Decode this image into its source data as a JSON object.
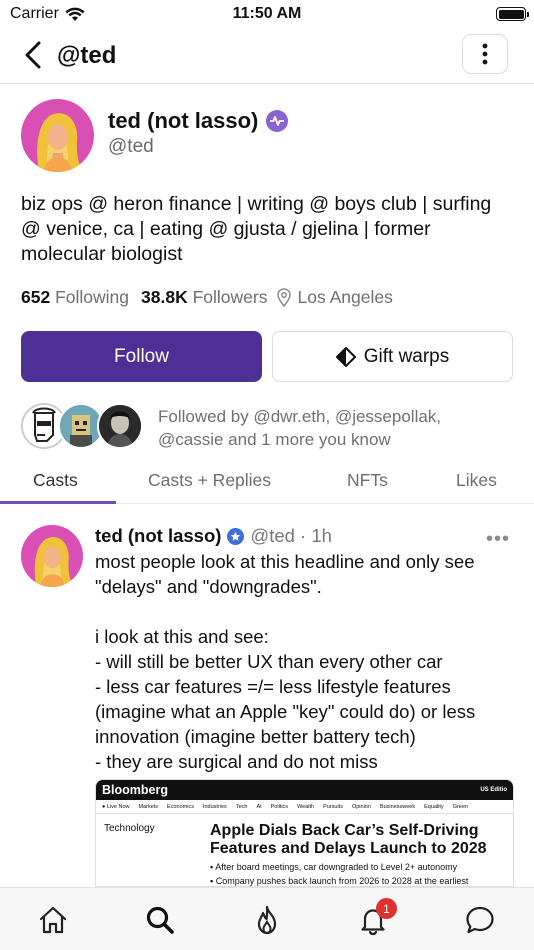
{
  "status_bar": {
    "carrier": "Carrier",
    "time": "11:50 AM"
  },
  "nav": {
    "title": "@ted"
  },
  "profile": {
    "display_name": "ted (not lasso)",
    "handle": "@ted",
    "bio": "biz ops @ heron finance | writing @ boys club | surfing @ venice, ca | eating @ gjusta / gjelina | former molecular biologist",
    "following_count": "652",
    "following_label": "Following",
    "followers_count": "38.8K",
    "followers_label": "Followers",
    "location": "Los Angeles",
    "follow_button": "Follow",
    "gift_button": "Gift warps",
    "followed_by": "Followed by @dwr.eth, @jessepollak, @cassie and 1 more you know"
  },
  "tabs": [
    {
      "label": "Casts",
      "active": true
    },
    {
      "label": "Casts + Replies",
      "active": false
    },
    {
      "label": "NFTs",
      "active": false
    },
    {
      "label": "Likes",
      "active": false
    }
  ],
  "cast": {
    "author": "ted (not lasso)",
    "handle": "@ted",
    "time": "1h",
    "text": "most people look at this headline and only see \"delays\" and \"downgrades\".\n\ni look at this and see:\n- will still be better UX than every other car\n- less car features =/= less lifestyle features (imagine what an Apple \"key\" could do) or less innovation (imagine better battery tech)\n- they are surgical and do not miss",
    "embed": {
      "brand": "Bloomberg",
      "edition": "US Editio",
      "nav_items": [
        "Live Now",
        "Markets",
        "Economics",
        "Industries",
        "Tech",
        "AI",
        "Politics",
        "Wealth",
        "Pursuits",
        "Opinion",
        "Businessweek",
        "Equality",
        "Green"
      ],
      "section": "Technology",
      "headline": "Apple Dials Back Car’s Self-Driving Features and Delays Launch to 2028",
      "bullets": [
        "After board meetings, car downgraded to Level 2+ autonomy",
        "Company pushes back launch from 2026 to 2028 at the earliest"
      ]
    }
  },
  "tab_bar": {
    "items": [
      "home-icon",
      "search-icon",
      "flame-icon",
      "bell-icon",
      "chat-icon"
    ],
    "notification_count": "1"
  },
  "colors": {
    "primary": "#4d2f96",
    "accent": "#8a63d2",
    "badge": "#e03131"
  }
}
